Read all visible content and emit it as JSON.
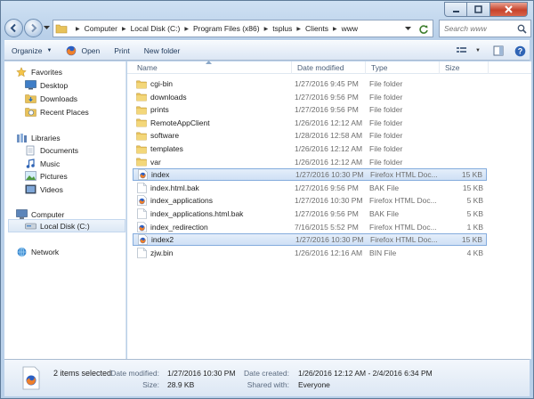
{
  "address": {
    "crumbs": [
      "Computer",
      "Local Disk (C:)",
      "Program Files (x86)",
      "tsplus",
      "Clients",
      "www"
    ]
  },
  "search": {
    "placeholder": "Search www"
  },
  "toolbar": {
    "organize": "Organize",
    "open": "Open",
    "print": "Print",
    "new_folder": "New folder"
  },
  "navpane": {
    "favorites": {
      "label": "Favorites",
      "items": [
        "Desktop",
        "Downloads",
        "Recent Places"
      ]
    },
    "libraries": {
      "label": "Libraries",
      "items": [
        "Documents",
        "Music",
        "Pictures",
        "Videos"
      ]
    },
    "computer": {
      "label": "Computer",
      "items": [
        "Local Disk (C:)"
      ]
    },
    "network": {
      "label": "Network"
    }
  },
  "columns": {
    "name": "Name",
    "date": "Date modified",
    "type": "Type",
    "size": "Size"
  },
  "files": [
    {
      "name": "cgi-bin",
      "date": "1/27/2016 9:45 PM",
      "type": "File folder",
      "size": "",
      "icon": "folder-icon"
    },
    {
      "name": "downloads",
      "date": "1/27/2016 9:56 PM",
      "type": "File folder",
      "size": "",
      "icon": "folder-icon"
    },
    {
      "name": "prints",
      "date": "1/27/2016 9:56 PM",
      "type": "File folder",
      "size": "",
      "icon": "folder-icon"
    },
    {
      "name": "RemoteAppClient",
      "date": "1/26/2016 12:12 AM",
      "type": "File folder",
      "size": "",
      "icon": "folder-icon"
    },
    {
      "name": "software",
      "date": "1/28/2016 12:58 AM",
      "type": "File folder",
      "size": "",
      "icon": "folder-icon"
    },
    {
      "name": "templates",
      "date": "1/26/2016 12:12 AM",
      "type": "File folder",
      "size": "",
      "icon": "folder-icon"
    },
    {
      "name": "var",
      "date": "1/26/2016 12:12 AM",
      "type": "File folder",
      "size": "",
      "icon": "folder-icon"
    },
    {
      "name": "index",
      "date": "1/27/2016 10:30 PM",
      "type": "Firefox HTML Doc...",
      "size": "15 KB",
      "icon": "firefox-document-icon",
      "selected": true
    },
    {
      "name": "index.html.bak",
      "date": "1/27/2016 9:56 PM",
      "type": "BAK File",
      "size": "15 KB",
      "icon": "blank-file-icon"
    },
    {
      "name": "index_applications",
      "date": "1/27/2016 10:30 PM",
      "type": "Firefox HTML Doc...",
      "size": "5 KB",
      "icon": "firefox-document-icon"
    },
    {
      "name": "index_applications.html.bak",
      "date": "1/27/2016 9:56 PM",
      "type": "BAK File",
      "size": "5 KB",
      "icon": "blank-file-icon"
    },
    {
      "name": "index_redirection",
      "date": "7/16/2015 5:52 PM",
      "type": "Firefox HTML Doc...",
      "size": "1 KB",
      "icon": "firefox-document-icon"
    },
    {
      "name": "index2",
      "date": "1/27/2016 10:30 PM",
      "type": "Firefox HTML Doc...",
      "size": "15 KB",
      "icon": "firefox-document-icon",
      "selected": true
    },
    {
      "name": "zjw.bin",
      "date": "1/26/2016 12:16 AM",
      "type": "BIN File",
      "size": "4 KB",
      "icon": "blank-file-icon"
    }
  ],
  "details": {
    "count": "2 items selected",
    "date_modified_label": "Date modified:",
    "date_modified": "1/27/2016 10:30 PM",
    "size_label": "Size:",
    "size": "28.9 KB",
    "date_created_label": "Date created:",
    "date_created": "1/26/2016 12:12 AM - 2/4/2016 6:34 PM",
    "shared_label": "Shared with:",
    "shared": "Everyone"
  },
  "colors": {
    "folder": "#e8c25a",
    "selection": "#cfe0f5",
    "selection_border": "#84acdd",
    "link_text": "#1e395b"
  }
}
